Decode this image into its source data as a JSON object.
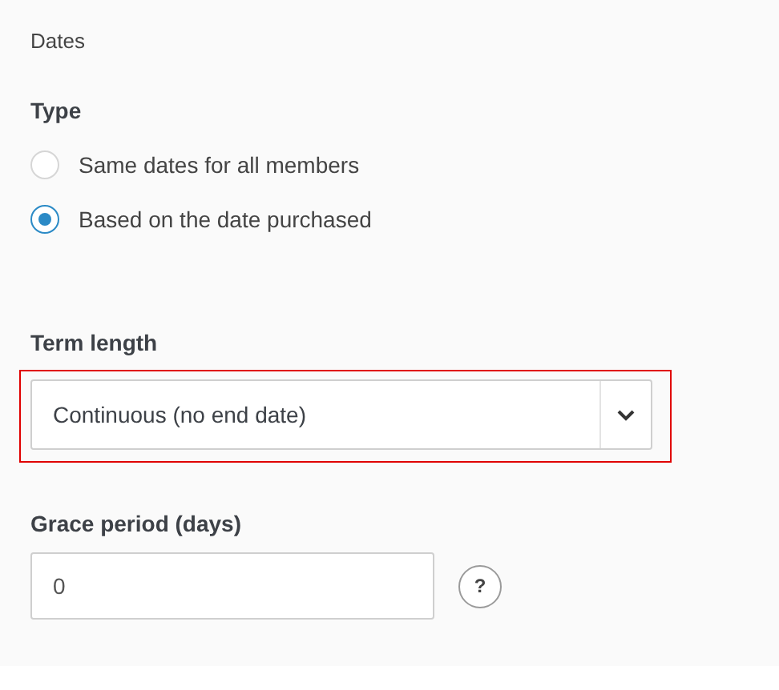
{
  "section_title": "Dates",
  "type": {
    "label": "Type",
    "options": [
      {
        "label": "Same dates for all members",
        "selected": false
      },
      {
        "label": "Based on the date purchased",
        "selected": true
      }
    ]
  },
  "term_length": {
    "label": "Term length",
    "value": "Continuous (no end date)",
    "highlighted": true
  },
  "grace_period": {
    "label": "Grace period (days)",
    "value": "0",
    "help": "?"
  }
}
